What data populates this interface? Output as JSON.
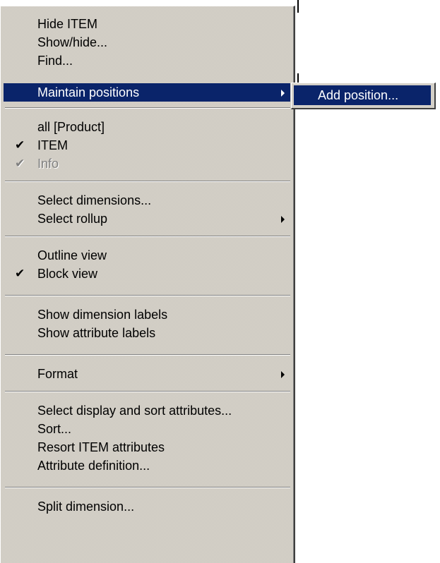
{
  "menu": {
    "items": [
      {
        "label": "Hide ITEM"
      },
      {
        "label": "Show/hide..."
      },
      {
        "label": "Find..."
      },
      {
        "label": "Maintain positions"
      },
      {
        "label": "all [Product]"
      },
      {
        "label": "ITEM",
        "check": "✔"
      },
      {
        "label": "Info",
        "check": "✔"
      },
      {
        "label": "Select dimensions..."
      },
      {
        "label": "Select rollup"
      },
      {
        "label": "Outline view"
      },
      {
        "label": "Block view",
        "check": "✔"
      },
      {
        "label": "Show dimension labels"
      },
      {
        "label": "Show attribute labels"
      },
      {
        "label": "Format"
      },
      {
        "label": "Select display and sort attributes..."
      },
      {
        "label": "Sort..."
      },
      {
        "label": "Resort ITEM attributes"
      },
      {
        "label": "Attribute definition..."
      },
      {
        "label": "Split dimension..."
      }
    ]
  },
  "submenu": {
    "items": [
      {
        "label": "Add position..."
      }
    ]
  },
  "colors": {
    "highlight": "#0a246a",
    "menu_face": "#d4d0c8",
    "disabled_text": "#808080"
  },
  "icons": {
    "check": "check-icon",
    "submenu_arrow": "submenu-arrow-icon"
  }
}
